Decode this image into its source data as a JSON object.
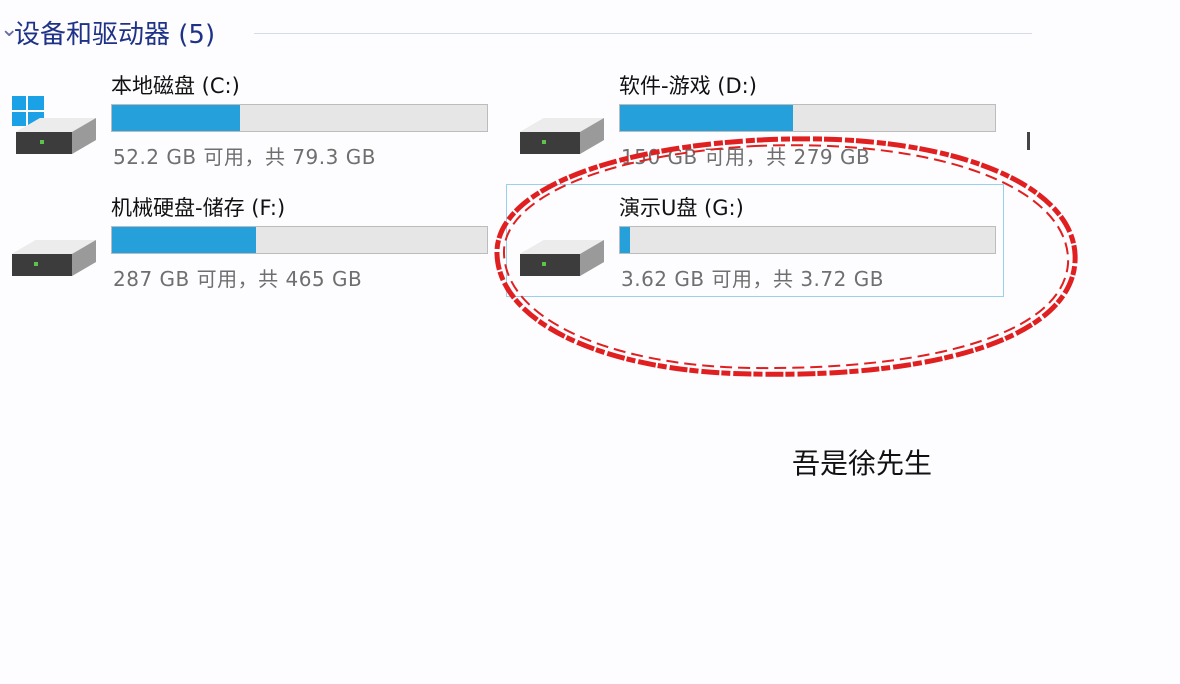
{
  "section": {
    "title": "设备和驱动器 (5)",
    "chevron_icon": "chevron-down-icon"
  },
  "drives": [
    {
      "name": "本地磁盘 (C:)",
      "space_text": "52.2 GB 可用，共 79.3 GB",
      "used_fraction": 0.342,
      "icon": "windows-drive-icon"
    },
    {
      "name": "软件-游戏 (D:)",
      "space_text": "150 GB 可用，共 279 GB",
      "used_fraction": 0.462,
      "icon": "hard-drive-icon"
    },
    {
      "name": "机械硬盘-储存 (F:)",
      "space_text": "287 GB 可用，共 465 GB",
      "used_fraction": 0.383,
      "icon": "hard-drive-icon"
    },
    {
      "name": "演示U盘 (G:)",
      "space_text": "3.62 GB 可用，共 3.72 GB",
      "used_fraction": 0.027,
      "icon": "usb-drive-icon",
      "selected": true
    }
  ],
  "caption": "吾是徐先生",
  "colors": {
    "bar_fill": "#26a0da",
    "bar_track": "#e6e6e6",
    "annotation": "#e02020",
    "header_text": "#1e3287"
  }
}
